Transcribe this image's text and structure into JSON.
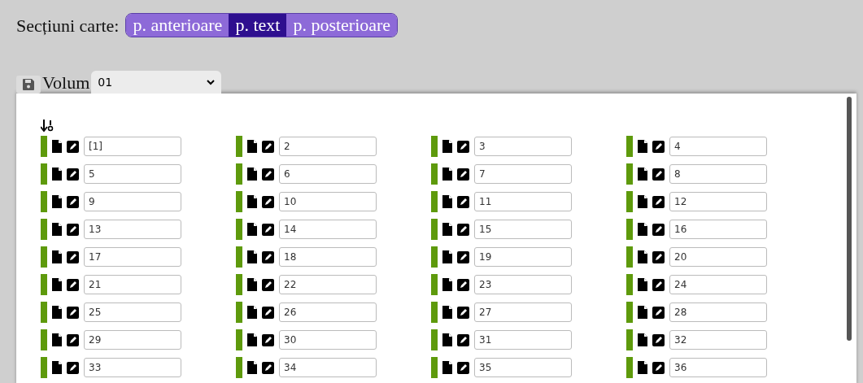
{
  "sections": {
    "label": "Secțiuni carte:",
    "tabs": [
      {
        "label": "p. anterioare",
        "selected": false
      },
      {
        "label": "p. text",
        "selected": true
      },
      {
        "label": "p. posterioare",
        "selected": false
      }
    ]
  },
  "volume": {
    "label": "Volum",
    "value": "01"
  },
  "pages": [
    "[1]",
    "2",
    "3",
    "4",
    "5",
    "6",
    "7",
    "8",
    "9",
    "10",
    "11",
    "12",
    "13",
    "14",
    "15",
    "16",
    "17",
    "18",
    "19",
    "20",
    "21",
    "22",
    "23",
    "24",
    "25",
    "26",
    "27",
    "28",
    "29",
    "30",
    "31",
    "32",
    "33",
    "34",
    "35",
    "36"
  ]
}
